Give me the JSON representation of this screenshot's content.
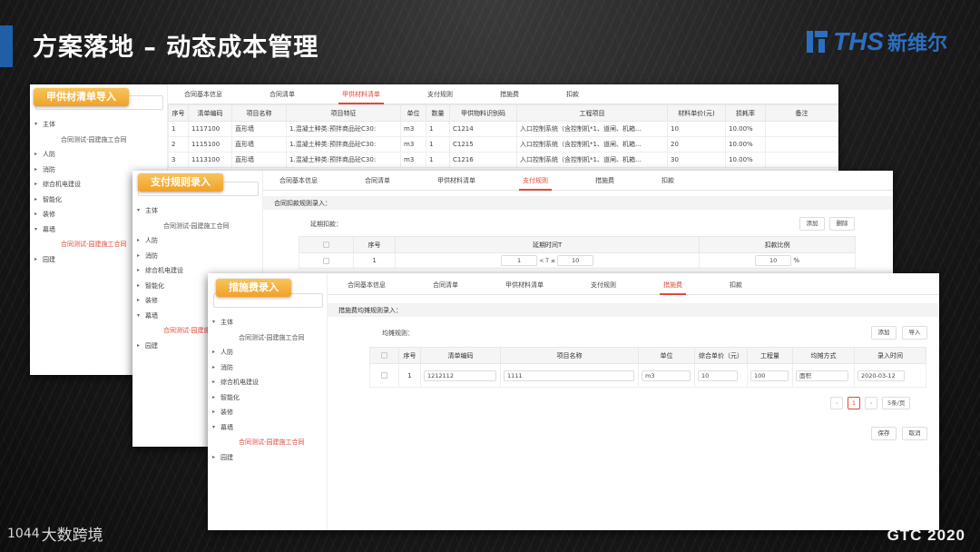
{
  "slide": {
    "title": "方案落地 – 动态成本管理",
    "brand_text": "THS",
    "brand_cn": "新维尔",
    "footer_left_num": "1044",
    "footer_left_text": "大数跨境",
    "footer_right": "GTC 2020",
    "accent_color": "#1f5fa8"
  },
  "window1": {
    "tag": "甲供材清单导入",
    "tree": [
      {
        "label": "主体",
        "children": [
          "合同测试-园建施工合同"
        ]
      },
      {
        "label": "人防"
      },
      {
        "label": "消防"
      },
      {
        "label": "综合机电建设"
      },
      {
        "label": "智能化"
      },
      {
        "label": "装修"
      },
      {
        "label": "幕墙",
        "children": [
          "合同测试-园建施工合同"
        ]
      },
      {
        "label": "园建"
      }
    ],
    "tabs": [
      "合同基本信息",
      "合同清单",
      "甲供材料清单",
      "支付规则",
      "措施费",
      "扣款"
    ],
    "active_tab": 2,
    "columns": [
      "序号",
      "清单编码",
      "项目名称",
      "项目特征",
      "单位",
      "数量",
      "甲供物料识别码",
      "工程项目",
      "材料单价(元)",
      "损耗率",
      "备注"
    ],
    "rows": [
      [
        "1",
        "1117100",
        "直形墙",
        "1.混凝土种类:预拌商品砼C30:",
        "m3",
        "1",
        "C1214",
        "入口控制系统（含控制机*1、道闸、机箱...",
        "10",
        "10.00%",
        ""
      ],
      [
        "2",
        "1115100",
        "直形墙",
        "1.混凝土种类:预拌商品砼C30:",
        "m3",
        "1",
        "C1215",
        "入口控制系统（含控制机*1、道闸、机箱...",
        "20",
        "10.00%",
        ""
      ],
      [
        "3",
        "1113100",
        "直形墙",
        "1.混凝土种类:预拌商品砼C30:",
        "m3",
        "1",
        "C1216",
        "入口控制系统（含控制机*1、道闸、机箱...",
        "30",
        "10.00%",
        ""
      ]
    ]
  },
  "window2": {
    "tag": "支付规则录入",
    "tree": [
      {
        "label": "主体",
        "children": [
          "合同测试-园建施工合同"
        ]
      },
      {
        "label": "人防"
      },
      {
        "label": "消防"
      },
      {
        "label": "综合机电建设"
      },
      {
        "label": "智能化"
      },
      {
        "label": "装修"
      },
      {
        "label": "幕墙",
        "children": [
          "合同测试-园建施工合同"
        ]
      },
      {
        "label": "园建"
      }
    ],
    "tabs": [
      "合同基本信息",
      "合同清单",
      "甲供材料清单",
      "支付规则",
      "措施费",
      "扣款"
    ],
    "active_tab": 3,
    "section": "合同扣款规则录入：",
    "sub_label": "延期扣款：",
    "buttons": {
      "add": "添加",
      "delete": "删除"
    },
    "columns": [
      "序号",
      "延期时间T",
      "扣款比例"
    ],
    "row": {
      "index": "1",
      "from": "1",
      "op": "< T ≤",
      "to": "10",
      "ratio": "10",
      "unit": "%"
    }
  },
  "window3": {
    "tag": "措施费录入",
    "tree": [
      {
        "label": "主体",
        "children": [
          "合同测试-园建施工合同"
        ]
      },
      {
        "label": "人防"
      },
      {
        "label": "消防"
      },
      {
        "label": "综合机电建设"
      },
      {
        "label": "智能化"
      },
      {
        "label": "装修"
      },
      {
        "label": "幕墙",
        "children": [
          "合同测试-园建施工合同"
        ]
      },
      {
        "label": "园建"
      }
    ],
    "tabs": [
      "合同基本信息",
      "合同清单",
      "甲供材料清单",
      "支付规则",
      "措施费",
      "扣款"
    ],
    "active_tab": 4,
    "section": "措施费均摊规则录入：",
    "sub_label": "均摊规则：",
    "buttons": {
      "add": "添加",
      "import": "导入",
      "save": "保存",
      "cancel": "取消"
    },
    "columns": [
      "序号",
      "清单编码",
      "项目名称",
      "单位",
      "综合单价（元）",
      "工程量",
      "均摊方式",
      "录入时间"
    ],
    "row": {
      "index": "1",
      "code": "1212112",
      "name": "1111",
      "unit": "m3",
      "price": "10",
      "qty": "100",
      "method": "面积",
      "date": "2020-03-12"
    },
    "pager": {
      "current": "1",
      "page_size": "5条/页"
    }
  }
}
